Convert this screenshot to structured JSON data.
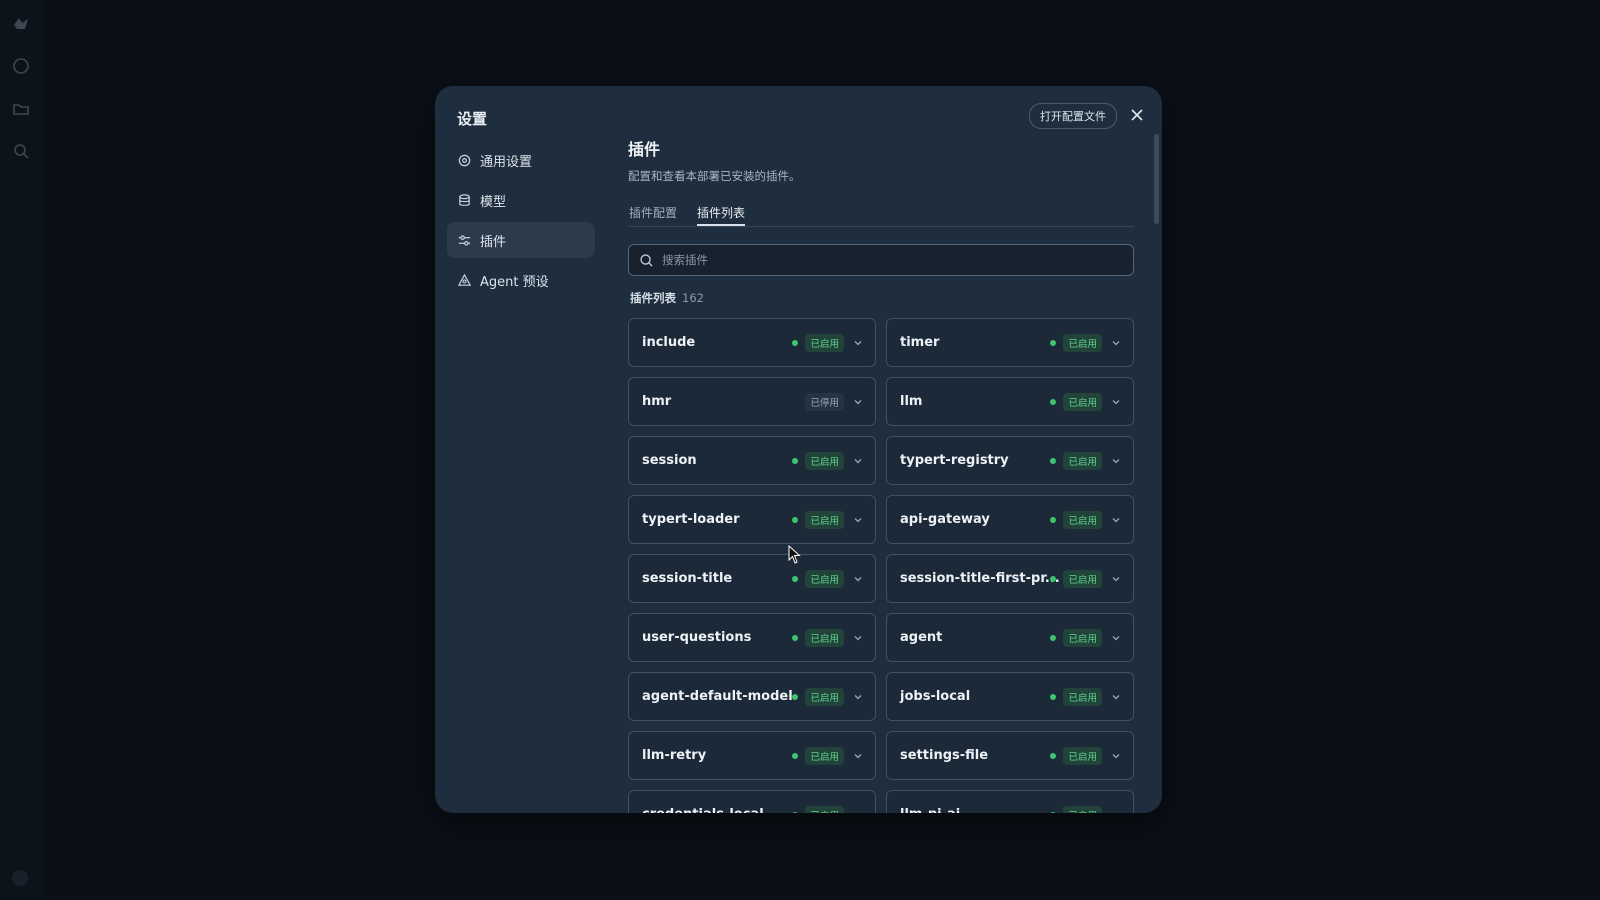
{
  "app": {
    "rail": [
      {
        "icon": "logo-icon"
      },
      {
        "icon": "chat-icon"
      },
      {
        "icon": "folder-icon"
      },
      {
        "icon": "search-icon"
      }
    ]
  },
  "dialog": {
    "title": "设置",
    "open_config_label": "打开配置文件",
    "close_icon": "close-icon"
  },
  "nav": {
    "items": [
      {
        "label": "通用设置",
        "icon": "gear-icon",
        "active": false
      },
      {
        "label": "模型",
        "icon": "database-icon",
        "active": false
      },
      {
        "label": "插件",
        "icon": "sliders-icon",
        "active": true
      },
      {
        "label": "Agent 预设",
        "icon": "agent-icon",
        "active": false
      }
    ]
  },
  "plugins": {
    "title": "插件",
    "description": "配置和查看本部署已安装的插件。",
    "tabs": [
      {
        "label": "插件配置",
        "active": false
      },
      {
        "label": "插件列表",
        "active": true
      }
    ],
    "search_placeholder": "搜索插件",
    "list_label": "插件列表",
    "count": "162",
    "items": [
      {
        "name": "include",
        "status": "已启用",
        "enabled": true
      },
      {
        "name": "timer",
        "status": "已启用",
        "enabled": true
      },
      {
        "name": "hmr",
        "status": "已停用",
        "enabled": false
      },
      {
        "name": "llm",
        "status": "已启用",
        "enabled": true
      },
      {
        "name": "session",
        "status": "已启用",
        "enabled": true
      },
      {
        "name": "typert-registry",
        "status": "已启用",
        "enabled": true
      },
      {
        "name": "typert-loader",
        "status": "已启用",
        "enabled": true
      },
      {
        "name": "api-gateway",
        "status": "已启用",
        "enabled": true
      },
      {
        "name": "session-title",
        "status": "已启用",
        "enabled": true
      },
      {
        "name": "session-title-first-pr...",
        "status": "已启用",
        "enabled": true
      },
      {
        "name": "user-questions",
        "status": "已启用",
        "enabled": true
      },
      {
        "name": "agent",
        "status": "已启用",
        "enabled": true
      },
      {
        "name": "agent-default-model",
        "status": "已启用",
        "enabled": true
      },
      {
        "name": "jobs-local",
        "status": "已启用",
        "enabled": true
      },
      {
        "name": "llm-retry",
        "status": "已启用",
        "enabled": true
      },
      {
        "name": "settings-file",
        "status": "已启用",
        "enabled": true
      },
      {
        "name": "credentials-local",
        "status": "已启用",
        "enabled": true
      },
      {
        "name": "llm-pi-ai",
        "status": "已启用",
        "enabled": true
      }
    ]
  },
  "colors": {
    "backdrop": "#0b1017",
    "modal": "#1e2e3f",
    "card": "#1b2938",
    "enabled_dot": "#3ec46d",
    "enabled_badge_text": "#5fd48c"
  }
}
